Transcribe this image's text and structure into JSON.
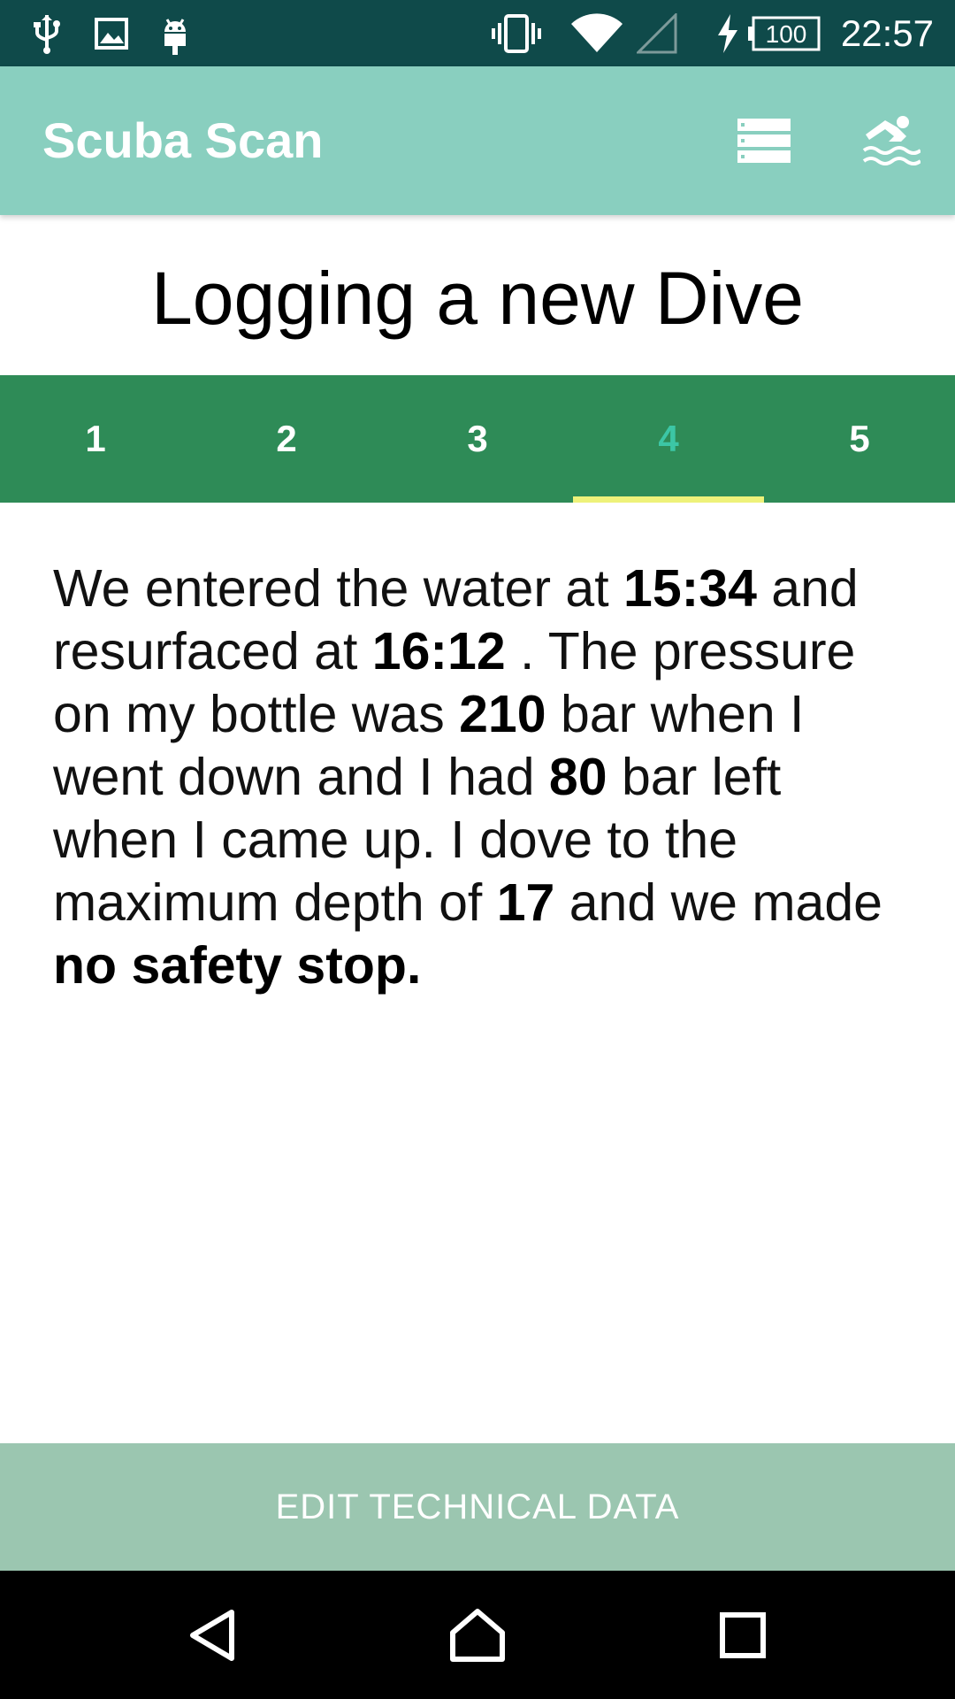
{
  "status_bar": {
    "time": "22:57",
    "battery": "100",
    "icons": [
      "usb-icon",
      "image-icon",
      "android-icon",
      "vibrate-icon",
      "wifi-icon",
      "signal-icon",
      "charging-icon",
      "battery-icon"
    ]
  },
  "app_bar": {
    "title": "Scuba Scan",
    "actions": [
      "list-icon",
      "swimmer-icon"
    ]
  },
  "page_title": "Logging a new Dive",
  "tabs": [
    {
      "label": "1",
      "active": false
    },
    {
      "label": "2",
      "active": false
    },
    {
      "label": "3",
      "active": false
    },
    {
      "label": "4",
      "active": true
    },
    {
      "label": "5",
      "active": false
    }
  ],
  "dive_summary": {
    "p1": "We entered the water at ",
    "entry_time": "15:34",
    "p2": " and resurfaced at ",
    "exit_time": "16:12",
    "p3": " . The pressure on my bottle was ",
    "start_pressure": "210",
    "p4": " bar when I went down and I had ",
    "end_pressure": "80",
    "p5": " bar left when I came up. I dove to the maximum depth of ",
    "max_depth": "17",
    "p6": " and we made ",
    "safety_stop": "no safety stop."
  },
  "bottom_button": {
    "label": "EDIT TECHNICAL DATA"
  },
  "nav_bar": {
    "buttons": [
      "back-icon",
      "home-icon",
      "recents-icon"
    ]
  },
  "colors": {
    "status_bar": "#0f4a4a",
    "app_bar": "#89cfbf",
    "tab_bar": "#2e8b57",
    "active_tab": "#3cc6a5",
    "indicator": "#eef27a",
    "bottom_button": "#9bc6b0"
  }
}
